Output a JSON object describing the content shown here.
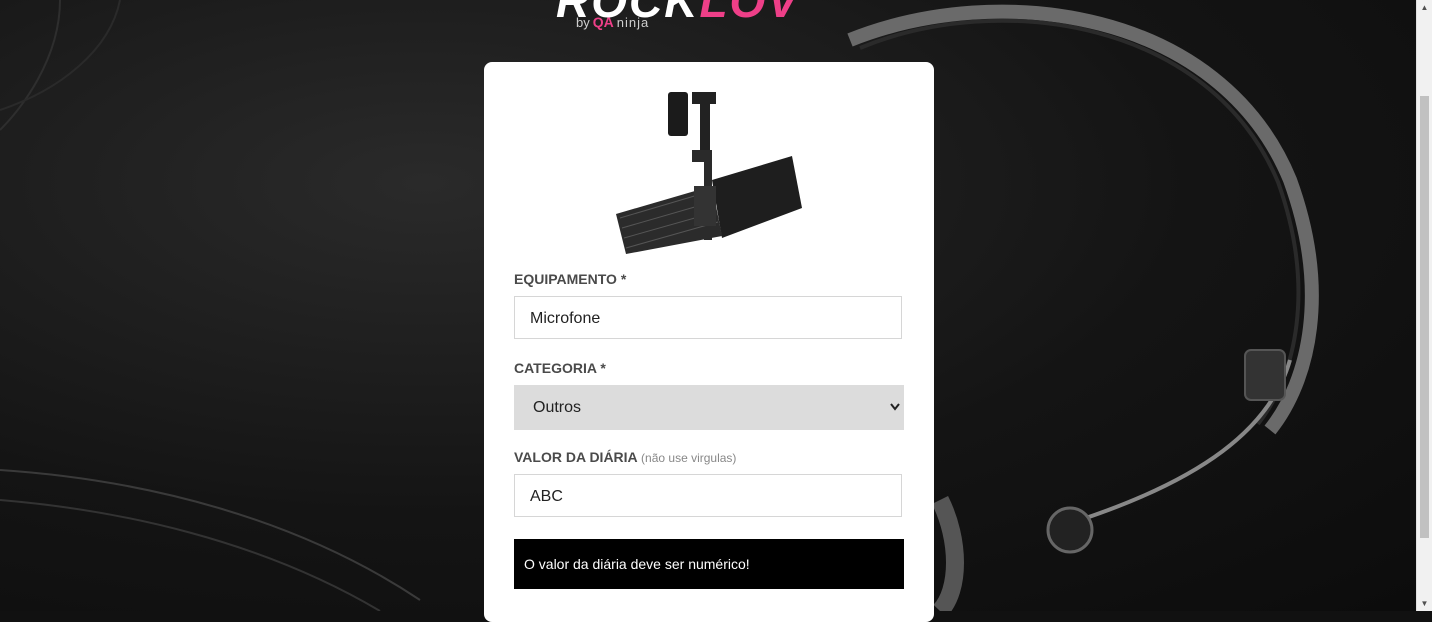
{
  "logo": {
    "main_white": "ROCK",
    "main_pink": "LOV",
    "by": "by",
    "qa": "QA",
    "ninja": "ninja"
  },
  "form": {
    "equipment_label": "EQUIPAMENTO *",
    "equipment_value": "Microfone",
    "category_label": "CATEGORIA *",
    "category_value": "Outros",
    "price_label": "VALOR DA DIÁRIA",
    "price_hint": "(não use virgulas)",
    "price_value": "ABC",
    "error_message": "O valor da diária deve ser numérico!"
  },
  "colors": {
    "brand_pink": "#ee3f88",
    "alert_bg": "#000000",
    "select_bg": "#dcdcdc"
  },
  "icons": {
    "select_arrow": "chevron-down-icon",
    "product_image": "microphone-icon"
  }
}
